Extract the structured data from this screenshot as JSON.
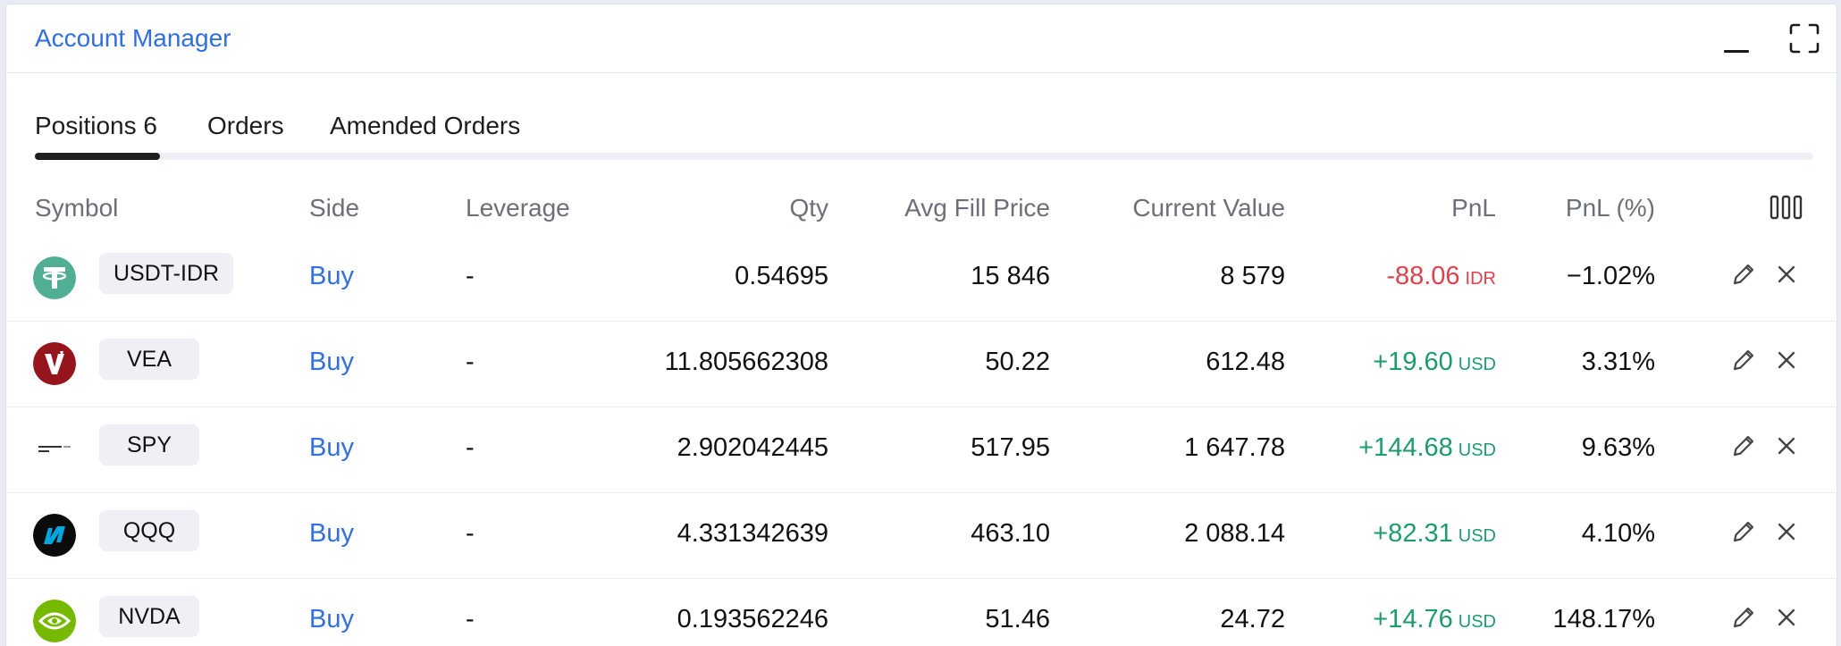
{
  "window": {
    "title": "Account Manager"
  },
  "tabs": [
    {
      "label": "Positions 6"
    },
    {
      "label": "Orders"
    },
    {
      "label": "Amended Orders"
    }
  ],
  "columns": [
    "Symbol",
    "Side",
    "Leverage",
    "Qty",
    "Avg Fill Price",
    "Current Value",
    "PnL",
    "PnL (%)"
  ],
  "positions": [
    {
      "symbol": "USDT-IDR",
      "icon": "tether-icon",
      "side": "Buy",
      "leverage": "-",
      "qty": "0.54695",
      "avg_fill_price": "15 846",
      "current_value": "8 579",
      "pnl": "-88.06",
      "pnl_currency": "IDR",
      "pnl_pct": "−1.02%"
    },
    {
      "symbol": "VEA",
      "icon": "vanguard-icon",
      "side": "Buy",
      "leverage": "-",
      "qty": "11.805662308",
      "avg_fill_price": "50.22",
      "current_value": "612.48",
      "pnl": "+19.60",
      "pnl_currency": "USD",
      "pnl_pct": "3.31%"
    },
    {
      "symbol": "SPY",
      "icon": "state-street-spdr-icon",
      "side": "Buy",
      "leverage": "-",
      "qty": "2.902042445",
      "avg_fill_price": "517.95",
      "current_value": "1 647.78",
      "pnl": "+144.68",
      "pnl_currency": "USD",
      "pnl_pct": "9.63%"
    },
    {
      "symbol": "QQQ",
      "icon": "nasdaq-icon",
      "side": "Buy",
      "leverage": "-",
      "qty": "4.331342639",
      "avg_fill_price": "463.10",
      "current_value": "2 088.14",
      "pnl": "+82.31",
      "pnl_currency": "USD",
      "pnl_pct": "4.10%"
    },
    {
      "symbol": "NVDA",
      "icon": "nvidia-icon",
      "side": "Buy",
      "leverage": "-",
      "qty": "0.193562246",
      "avg_fill_price": "51.46",
      "current_value": "24.72",
      "pnl": "+14.76",
      "pnl_currency": "USD",
      "pnl_pct": "148.17%"
    }
  ],
  "colors": {
    "accent": "#2f6fe0",
    "positive": "#1e9b6e",
    "negative": "#e0404a"
  }
}
